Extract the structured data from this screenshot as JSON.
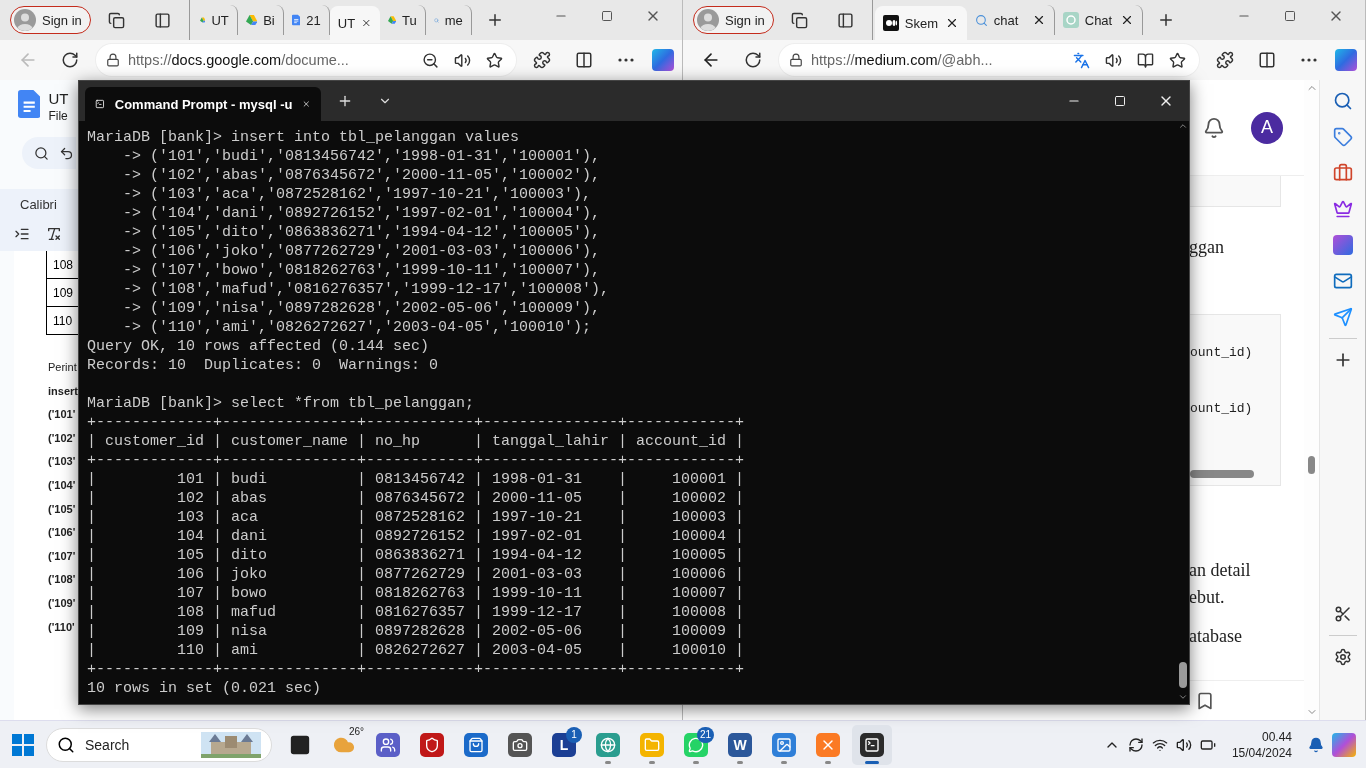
{
  "browsers": [
    {
      "sign_in": "Sign in",
      "back_enabled": false,
      "address": {
        "scheme": "https://",
        "host": "docs.google.com",
        "path": "/docume..."
      },
      "tabs": [
        {
          "label": "UT",
          "kind": "drive",
          "selected": false,
          "closable": false
        },
        {
          "label": "Bi",
          "kind": "drive",
          "selected": false,
          "closable": false
        },
        {
          "label": "21",
          "kind": "docs",
          "selected": false,
          "closable": false
        },
        {
          "label": "UT",
          "kind": "plain",
          "selected": true,
          "closable": true
        },
        {
          "label": "Tu",
          "kind": "drive",
          "selected": false,
          "closable": false
        },
        {
          "label": "me",
          "kind": "search",
          "selected": false,
          "closable": false
        }
      ]
    },
    {
      "sign_in": "Sign in",
      "back_enabled": true,
      "address": {
        "scheme": "https://",
        "host": "medium.com",
        "path": "/@abh..."
      },
      "tabs": [
        {
          "label": "Skem",
          "kind": "medium",
          "selected": true,
          "closable": true
        },
        {
          "label": "chat",
          "kind": "search",
          "selected": false,
          "closable": true
        },
        {
          "label": "Chat",
          "kind": "chatgpt",
          "selected": false,
          "closable": true
        }
      ]
    }
  ],
  "docs_strip": {
    "title": "UT",
    "menu": "File",
    "font": "Calibri",
    "table_cells": [
      "108",
      "109",
      "110"
    ],
    "lines": [
      {
        "text": "Perint",
        "bold": false
      },
      {
        "text": "insert",
        "bold": true
      },
      {
        "text": "('101'",
        "bold": true
      },
      {
        "text": "('102'",
        "bold": true
      },
      {
        "text": "('103'",
        "bold": true
      },
      {
        "text": "('104'",
        "bold": true
      },
      {
        "text": "('105'",
        "bold": true
      },
      {
        "text": "('106'",
        "bold": true
      },
      {
        "text": "('107'",
        "bold": true
      },
      {
        "text": "('108'",
        "bold": true
      },
      {
        "text": "('109'",
        "bold": true
      },
      {
        "text": "('110'",
        "bold": true
      }
    ]
  },
  "medium_strip": {
    "avatar": "A",
    "heading": "ggan",
    "code_lines": [
      "ount_id)",
      "ount_id)"
    ],
    "paragraph_lines": [
      "an detail",
      "ebut.",
      "atabase"
    ]
  },
  "terminal": {
    "tab_title": "Command Prompt - mysql  -u",
    "blocks": [
      [
        "MariaDB [bank]> insert into tbl_pelanggan values",
        "    -> ('101','budi','0813456742','1998-01-31','100001'),",
        "    -> ('102','abas','0876345672','2000-11-05','100002'),",
        "    -> ('103','aca','0872528162','1997-10-21','100003'),",
        "    -> ('104','dani','0892726152','1997-02-01','100004'),",
        "    -> ('105','dito','0863836271','1994-04-12','100005'),",
        "    -> ('106','joko','0877262729','2001-03-03','100006'),",
        "    -> ('107','bowo','0818262763','1999-10-11','100007'),",
        "    -> ('108','mafud','0816276357','1999-12-17','100008'),",
        "    -> ('109','nisa','0897282628','2002-05-06','100009'),",
        "    -> ('110','ami','0826272627','2003-04-05','100010');",
        "Query OK, 10 rows affected (0.144 sec)",
        "Records: 10  Duplicates: 0  Warnings: 0"
      ],
      [
        "MariaDB [bank]> select *from tbl_pelanggan;",
        "+-------------+---------------+------------+---------------+------------+",
        "| customer_id | customer_name | no_hp      | tanggal_lahir | account_id |",
        "+-------------+---------------+------------+---------------+------------+",
        "|         101 | budi          | 0813456742 | 1998-01-31    |     100001 |",
        "|         102 | abas          | 0876345672 | 2000-11-05    |     100002 |",
        "|         103 | aca           | 0872528162 | 1997-10-21    |     100003 |",
        "|         104 | dani          | 0892726152 | 1997-02-01    |     100004 |",
        "|         105 | dito          | 0863836271 | 1994-04-12    |     100005 |",
        "|         106 | joko          | 0877262729 | 2001-03-03    |     100006 |",
        "|         107 | bowo          | 0818262763 | 1999-10-11    |     100007 |",
        "|         108 | mafud         | 0816276357 | 1999-12-17    |     100008 |",
        "|         109 | nisa          | 0897282628 | 2002-05-06    |     100009 |",
        "|         110 | ami           | 0826272627 | 2003-04-05    |     100010 |",
        "+-------------+---------------+------------+---------------+------------+",
        "10 rows in set (0.021 sec)"
      ]
    ]
  },
  "taskbar": {
    "search_placeholder": "Search",
    "time": "00.44",
    "date": "15/04/2024",
    "apps": [
      {
        "kind": "taskview",
        "running": false,
        "active": false
      },
      {
        "kind": "weather",
        "label": "26°",
        "running": false,
        "active": false
      },
      {
        "kind": "teams",
        "running": false,
        "active": false
      },
      {
        "kind": "shield",
        "running": false,
        "active": false
      },
      {
        "kind": "store",
        "running": false,
        "active": false
      },
      {
        "kind": "camera",
        "running": false,
        "active": false
      },
      {
        "kind": "letter",
        "label": "L",
        "badge": "1",
        "running": false,
        "active": false
      },
      {
        "kind": "edge",
        "running": true,
        "active": false
      },
      {
        "kind": "folder",
        "running": true,
        "active": false
      },
      {
        "kind": "chat",
        "badge": "21",
        "running": true,
        "active": false
      },
      {
        "kind": "word",
        "label": "W",
        "running": true,
        "active": false
      },
      {
        "kind": "photos",
        "running": true,
        "active": false
      },
      {
        "kind": "xampp",
        "running": true,
        "active": false
      },
      {
        "kind": "terminal",
        "running": true,
        "active": true
      }
    ]
  }
}
